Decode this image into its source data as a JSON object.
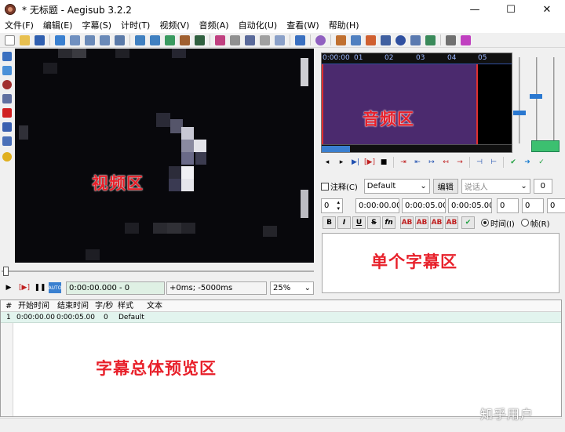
{
  "window": {
    "title": "* 无标题 - Aegisub 3.2.2",
    "minimize_glyph": "—",
    "maximize_glyph": "☐",
    "close_glyph": "✕"
  },
  "menu": [
    "文件(F)",
    "编辑(E)",
    "字幕(S)",
    "计时(T)",
    "视频(V)",
    "音频(A)",
    "自动化(U)",
    "查看(W)",
    "帮助(H)"
  ],
  "annotations": {
    "video": "视频区",
    "audio": "音频区",
    "single_sub": "单个字幕区",
    "overview": "字幕总体预览区"
  },
  "video_controls": {
    "play_glyph": "▶",
    "play_line_glyph": "[▶]",
    "pause_glyph": "❚❚",
    "auto_label": "AUTO",
    "time_field": "0:00:00.000 - 0",
    "offset_field": "+0ms; -5000ms",
    "zoom_value": "25%"
  },
  "audio": {
    "ruler_labels": [
      "0:00:00",
      "01",
      "02",
      "03",
      "04",
      "05"
    ]
  },
  "subtitle_edit": {
    "comment_label": "注释(C)",
    "style_value": "Default",
    "edit_button": "编辑",
    "actor_placeholder": "说话人",
    "effect_value": "0",
    "layer_value": "0",
    "start_time": "0:00:00.00",
    "end_time": "0:00:05.00",
    "duration": "0:00:05.00",
    "margin_l": "0",
    "margin_r": "0",
    "margin_v": "0",
    "bold": "B",
    "italic": "I",
    "underline": "U",
    "strike": "S",
    "font": "fn",
    "color_labels": [
      "AB",
      "AB",
      "AB",
      "AB"
    ],
    "commit_glyph": "✔",
    "time_mode_label": "时间(I)",
    "frame_mode_label": "帧(R)"
  },
  "grid": {
    "headers": [
      "#",
      "开始时间",
      "结束时间",
      "字/秒",
      "样式",
      "文本"
    ],
    "rows": [
      {
        "num": "1",
        "start": "0:00:00.00",
        "end": "0:00:05.00",
        "cps": "0",
        "style": "Default",
        "text": ""
      }
    ]
  },
  "watermark": "知乎用户",
  "colors": {
    "accent_red": "#e8202a",
    "audio_selection": "#4b2a6e",
    "grid_row": "#e2f4ee",
    "slider_blue": "#2a78d0"
  }
}
